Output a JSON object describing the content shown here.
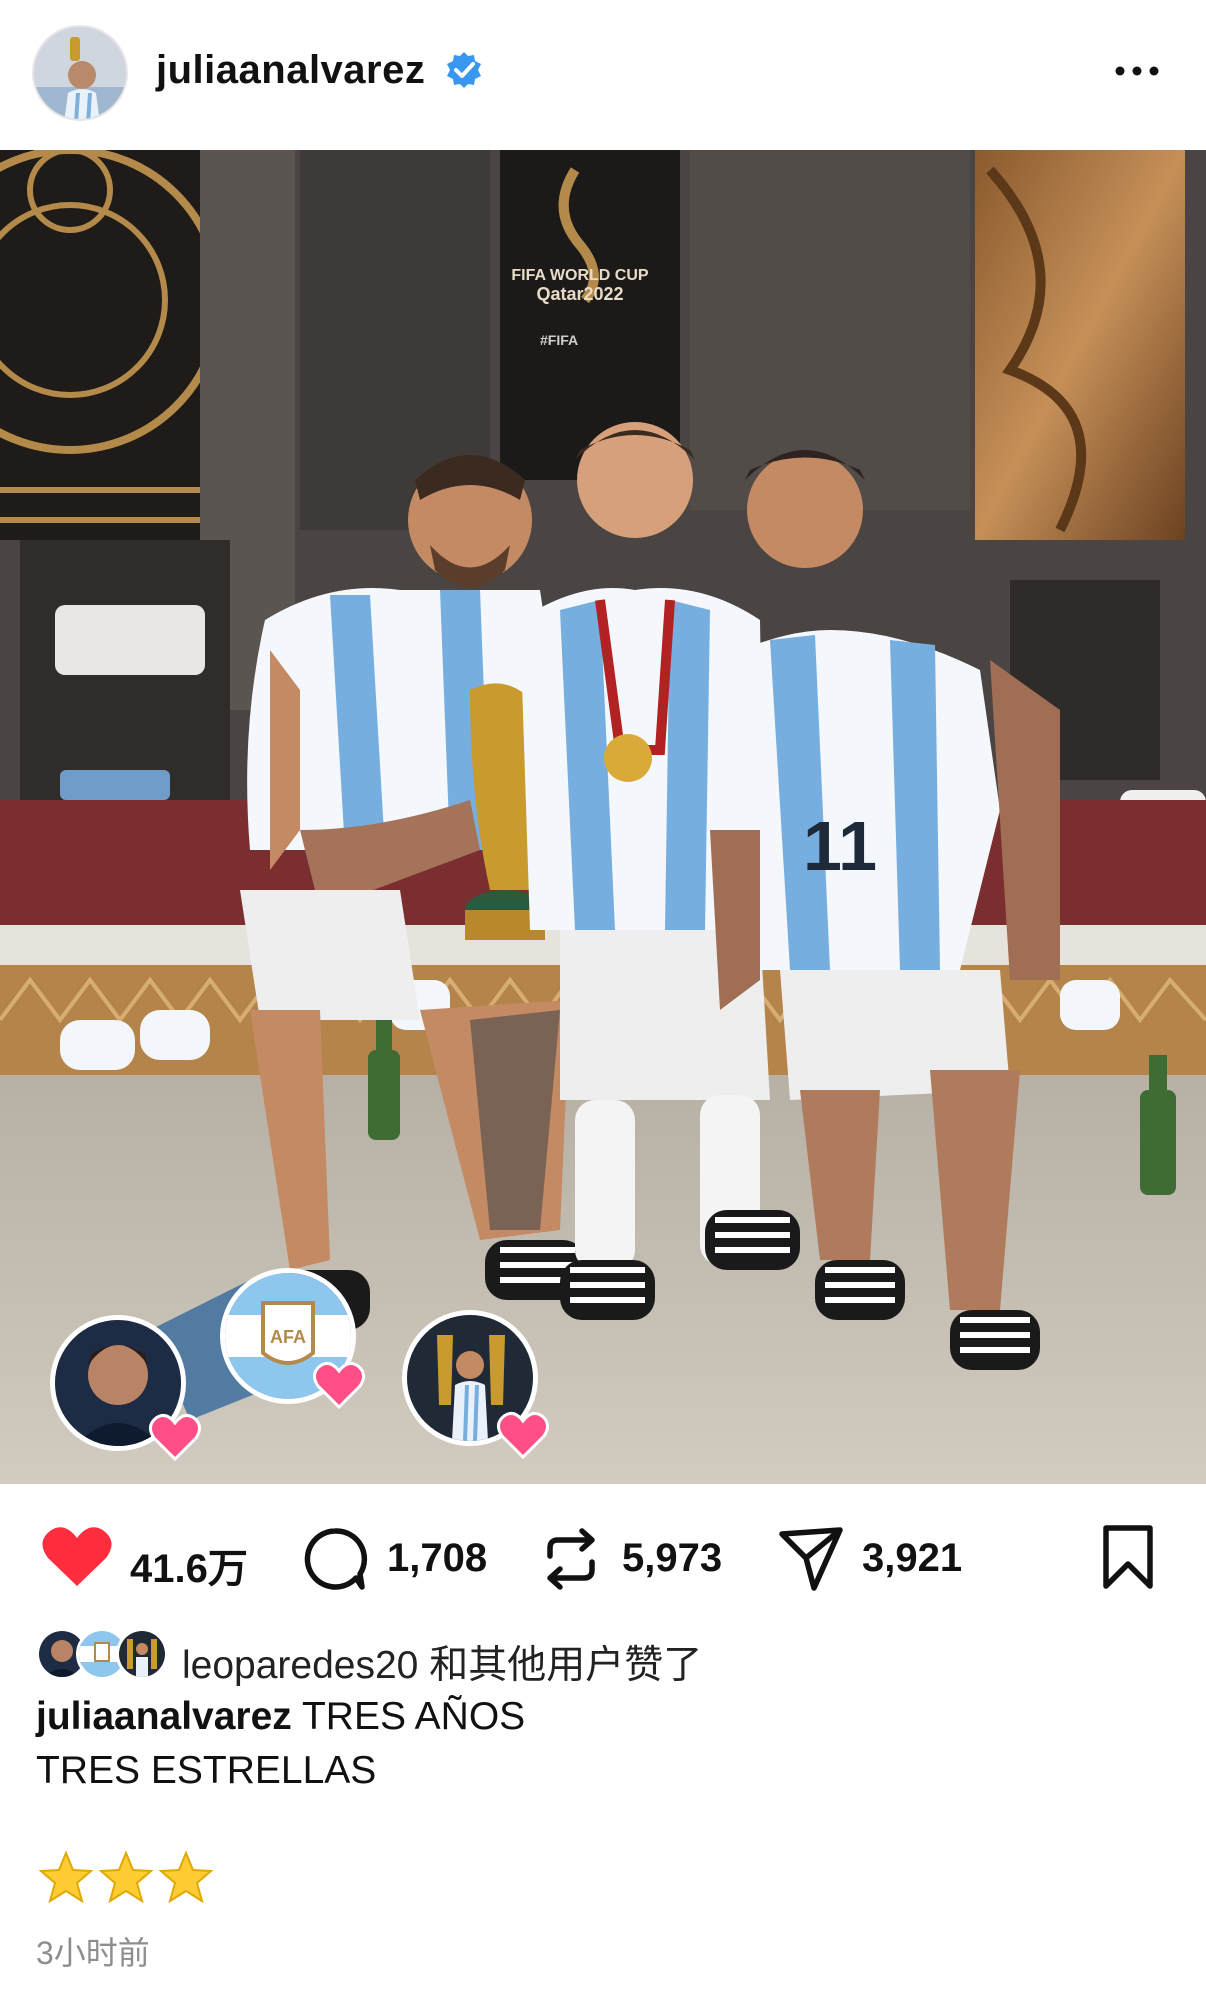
{
  "header": {
    "username": "juliaanalvarez",
    "verified_icon": "verified-badge-icon",
    "more_icon": "more-dots-icon"
  },
  "post": {
    "photo_description": "Three Argentina players in a locker room with the World Cup trophy",
    "text_in_photo": [
      "FIFA WORLD CUP",
      "Qatar2022",
      "#FIFA"
    ],
    "jersey_number": "11",
    "tagged_avatars": [
      "leoparedes-avatar",
      "afa-logo-avatar",
      "trophy-photo-avatar"
    ]
  },
  "actions": {
    "likes": "41.6万",
    "comments": "1,708",
    "reposts": "5,973",
    "shares": "3,921",
    "colors": {
      "heart": "#ff2d3e",
      "verified": "#3897f0"
    }
  },
  "liked_by": {
    "text": "leoparedes20 和其他用户赞了"
  },
  "caption": {
    "username": "juliaanalvarez",
    "line1": "TRES AÑOS",
    "line2": "TRES ESTRELLAS",
    "stars": "⭐⭐⭐"
  },
  "timestamp": "3小时前"
}
